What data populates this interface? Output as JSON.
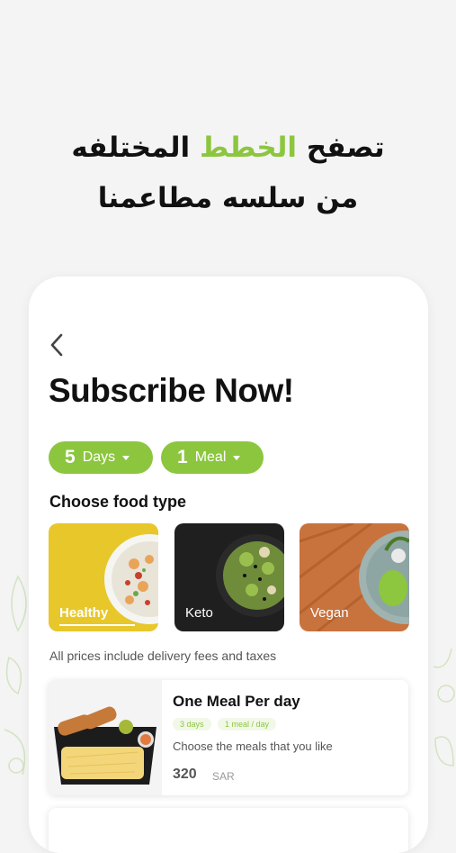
{
  "promo": {
    "line1_start": "تصفح ",
    "line1_accent": "الخطط",
    "line1_end": " المختلفه",
    "line2": "من سلسه مطاعمنا"
  },
  "screen": {
    "title": "Subscribe Now!",
    "days_pill": {
      "number": "5",
      "label": "Days"
    },
    "meals_pill": {
      "number": "1",
      "label": "Meal"
    },
    "section_title": "Choose food type",
    "food_types": [
      {
        "label": "Healthy",
        "selected": true
      },
      {
        "label": "Keto",
        "selected": false
      },
      {
        "label": "Vegan",
        "selected": false
      }
    ],
    "note": "All prices include delivery fees and taxes",
    "meal_card": {
      "title": "One Meal Per day",
      "tags": [
        "3 days",
        "1 meal / day"
      ],
      "description": "Choose the meals that you like",
      "price": "320",
      "currency": "SAR"
    }
  },
  "colors": {
    "accent": "#8cc63f",
    "background": "#f4f4f4"
  }
}
